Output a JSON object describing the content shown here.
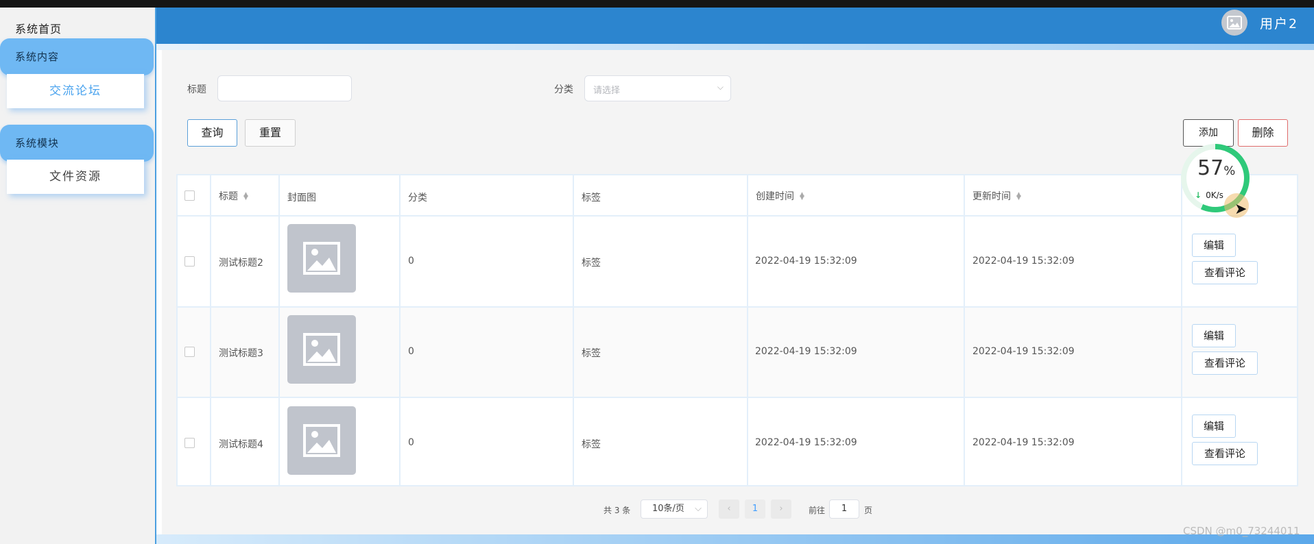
{
  "sidebar": {
    "home": "系统首页",
    "group1": "系统内容",
    "group1_item": "交流论坛",
    "group2": "系统模块",
    "group2_item": "文件资源"
  },
  "header": {
    "username": "用户2"
  },
  "filters": {
    "title_label": "标题",
    "title_value": "",
    "category_label": "分类",
    "category_placeholder": "请选择"
  },
  "buttons": {
    "query": "查询",
    "reset": "重置",
    "add": "添加",
    "delete": "删除"
  },
  "table": {
    "columns": [
      "标题",
      "封面图",
      "分类",
      "标签",
      "创建时间",
      "更新时间"
    ],
    "rows": [
      {
        "title": "测试标题2",
        "category": "0",
        "tag": "标签",
        "created": "2022-04-19 15:32:09",
        "updated": "2022-04-19 15:32:09",
        "edit": "编辑",
        "comments": "查看评论"
      },
      {
        "title": "测试标题3",
        "category": "0",
        "tag": "标签",
        "created": "2022-04-19 15:32:09",
        "updated": "2022-04-19 15:32:09",
        "edit": "编辑",
        "comments": "查看评论"
      },
      {
        "title": "测试标题4",
        "category": "0",
        "tag": "标签",
        "created": "2022-04-19 15:32:09",
        "updated": "2022-04-19 15:32:09",
        "edit": "编辑",
        "comments": "查看评论"
      }
    ]
  },
  "pagination": {
    "total": "共 3 条",
    "page_size": "10条/页",
    "current_page": "1",
    "goto_label": "前往",
    "goto_value": "1",
    "page_suffix": "页",
    "prev_icon": "‹",
    "next_icon": "›"
  },
  "speed_widget": {
    "percent": "57",
    "percent_sign": "%",
    "rate": "0K/s"
  },
  "watermark": "CSDN @m0_73244011",
  "colors": {
    "header": "#2c85cf",
    "sidebar_group": "#6fb8f3",
    "accent": "#409eff"
  }
}
